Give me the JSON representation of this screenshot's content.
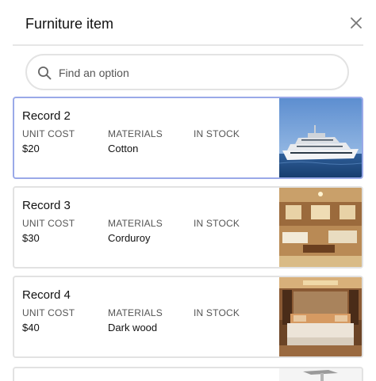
{
  "dialog": {
    "title": "Furniture item",
    "close_icon": "close-icon"
  },
  "search": {
    "placeholder": "Find an option",
    "value": "",
    "icon": "search-icon"
  },
  "columns": {
    "unit_cost": "UNIT COST",
    "materials": "MATERIALS",
    "in_stock": "IN STOCK"
  },
  "records": [
    {
      "name": "Record 2",
      "unit_cost": "$20",
      "materials": "Cotton",
      "in_stock": "",
      "image": "yacht-exterior-photo",
      "selected": true
    },
    {
      "name": "Record 3",
      "unit_cost": "$30",
      "materials": "Corduroy",
      "in_stock": "",
      "image": "yacht-salon-photo",
      "selected": false
    },
    {
      "name": "Record 4",
      "unit_cost": "$40",
      "materials": "Dark wood",
      "in_stock": "",
      "image": "yacht-bedroom-photo",
      "selected": false
    }
  ],
  "colors": {
    "selected_border": "#9aa9e8",
    "card_border": "#e2e2e2"
  }
}
